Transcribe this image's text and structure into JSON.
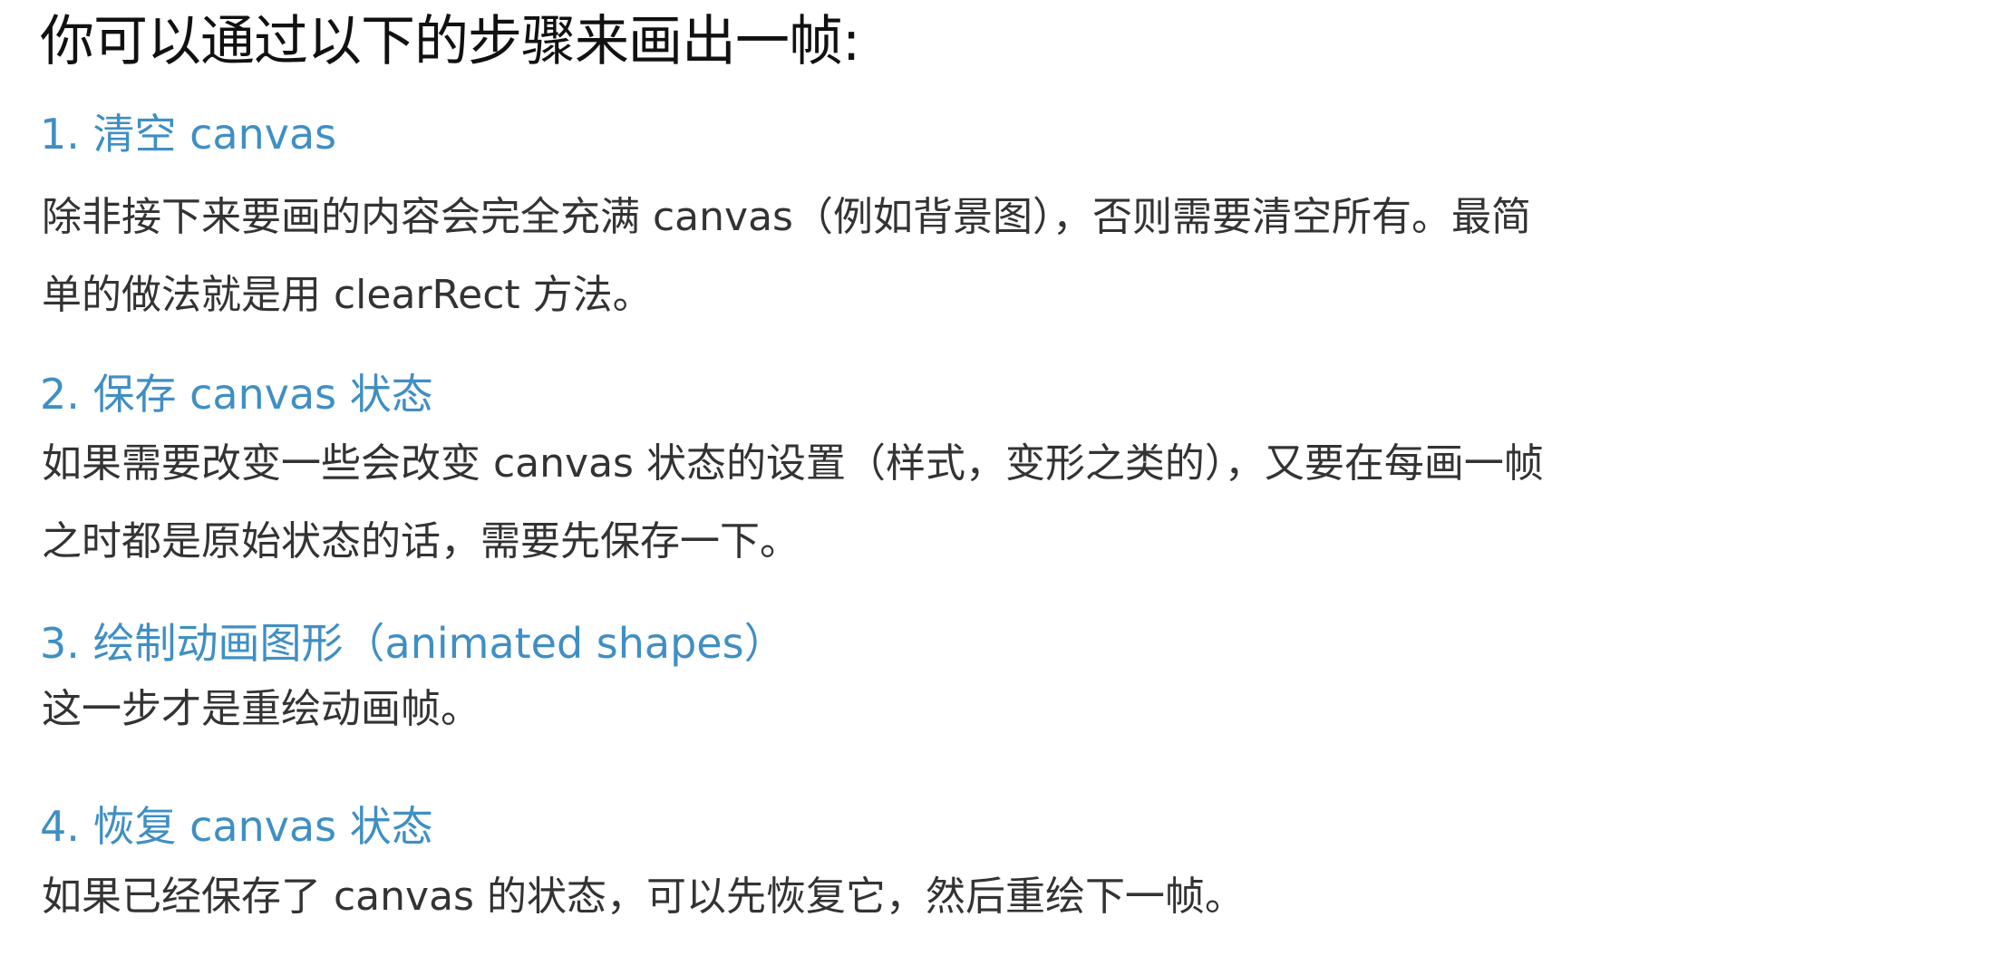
{
  "title": "你可以通过以下的步骤来画出一帧:",
  "steps": [
    {
      "heading": "1. 清空 canvas",
      "lines": [
        "除非接下来要画的内容会完全充满 canvas（例如背景图），否则需要清空所有。最简",
        "单的做法就是用 clearRect 方法。"
      ]
    },
    {
      "heading": "2. 保存 canvas 状态",
      "lines": [
        "如果需要改变一些会改变 canvas 状态的设置（样式，变形之类的），又要在每画一帧",
        "之时都是原始状态的话，需要先保存一下。"
      ]
    },
    {
      "heading": "3. 绘制动画图形（animated shapes）",
      "lines": [
        "这一步才是重绘动画帧。"
      ]
    },
    {
      "heading": "4. 恢复 canvas 状态",
      "lines": [
        "如果已经保存了 canvas 的状态，可以先恢复它，然后重绘下一帧。"
      ]
    }
  ],
  "colors": {
    "heading": "#3f8fc4",
    "body": "#333333",
    "title": "#111111"
  }
}
